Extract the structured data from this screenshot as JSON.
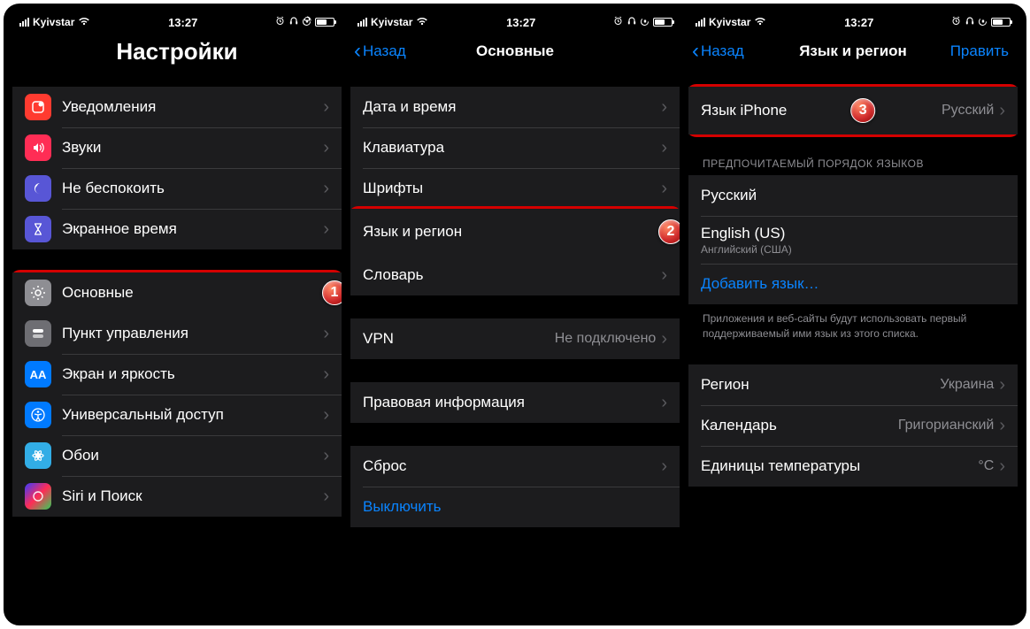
{
  "status": {
    "carrier": "Kyivstar",
    "time": "13:27"
  },
  "screen1": {
    "title": "Настройки",
    "group1": [
      {
        "label": "Уведомления"
      },
      {
        "label": "Звуки"
      },
      {
        "label": "Не беспокоить"
      },
      {
        "label": "Экранное время"
      }
    ],
    "group2": [
      {
        "label": "Основные"
      },
      {
        "label": "Пункт управления"
      },
      {
        "label": "Экран и яркость"
      },
      {
        "label": "Универсальный доступ"
      },
      {
        "label": "Обои"
      },
      {
        "label": "Siri и Поиск"
      }
    ],
    "badge": "1"
  },
  "screen2": {
    "back": "Назад",
    "title": "Основные",
    "group1": [
      {
        "label": "Дата и время"
      },
      {
        "label": "Клавиатура"
      },
      {
        "label": "Шрифты"
      },
      {
        "label": "Язык и регион"
      },
      {
        "label": "Словарь"
      }
    ],
    "vpn": {
      "label": "VPN",
      "value": "Не подключено"
    },
    "legal": {
      "label": "Правовая информация"
    },
    "reset": {
      "label": "Сброс"
    },
    "shutdown": {
      "label": "Выключить"
    },
    "badge": "2"
  },
  "screen3": {
    "back": "Назад",
    "title": "Язык и регион",
    "edit": "Править",
    "iphone_lang": {
      "label": "Язык iPhone",
      "value": "Русский"
    },
    "pref_header": "ПРЕДПОЧИТАЕМЫЙ ПОРЯДОК ЯЗЫКОВ",
    "langs": [
      {
        "label": "Русский"
      },
      {
        "label": "English (US)",
        "sub": "Английский (США)"
      }
    ],
    "add_lang": "Добавить язык…",
    "pref_footer": "Приложения и веб-сайты будут использовать первый поддерживаемый ими язык из этого списка.",
    "region": {
      "label": "Регион",
      "value": "Украина"
    },
    "calendar": {
      "label": "Календарь",
      "value": "Григорианский"
    },
    "temp": {
      "label": "Единицы температуры",
      "value": "°C"
    },
    "badge": "3"
  }
}
